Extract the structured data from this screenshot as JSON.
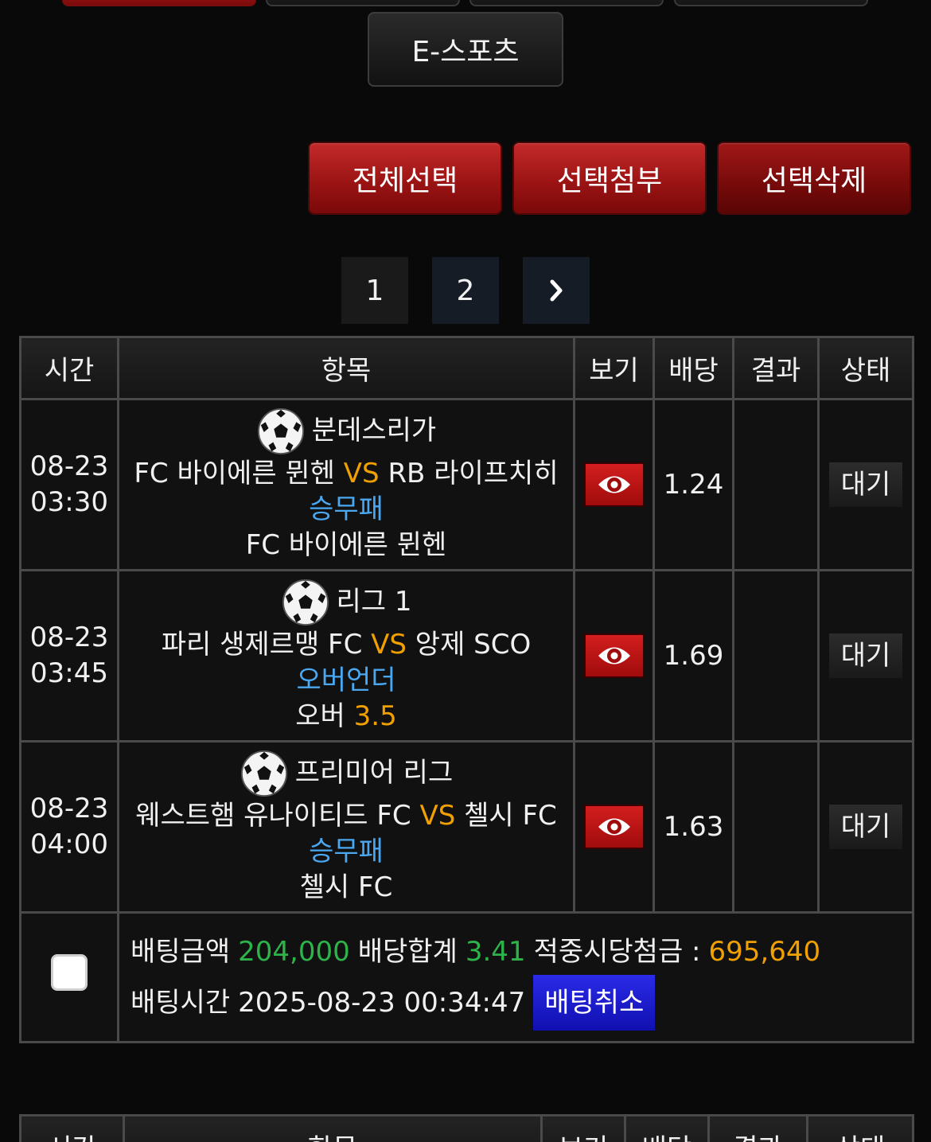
{
  "top_nav": {
    "esports_label": "E-스포츠"
  },
  "actions": {
    "select_all": "전체선택",
    "attach_selected": "선택첨부",
    "delete_selected": "선택삭제"
  },
  "pagination": {
    "pages": [
      "1",
      "2"
    ],
    "next": "›"
  },
  "table_headers": [
    "시간",
    "항목",
    "보기",
    "배당",
    "결과",
    "상태"
  ],
  "bets": [
    {
      "date": "08-23",
      "time": "03:30",
      "league": "분데스리가",
      "home": "FC 바이에른 뮌헨",
      "vs": "VS",
      "away": "RB 라이프치히",
      "market": "승무패",
      "pick": "FC 바이에른 뮌헨",
      "pick_value": "",
      "odds": "1.24",
      "result": "",
      "status": "대기"
    },
    {
      "date": "08-23",
      "time": "03:45",
      "league": "리그 1",
      "home": "파리 생제르맹 FC",
      "vs": "VS",
      "away": "앙제 SCO",
      "market": "오버언더",
      "pick": "오버",
      "pick_value": "3.5",
      "odds": "1.69",
      "result": "",
      "status": "대기"
    },
    {
      "date": "08-23",
      "time": "04:00",
      "league": "프리미어 리그",
      "home": "웨스트햄 유나이티드 FC",
      "vs": "VS",
      "away": "첼시 FC",
      "market": "승무패",
      "pick": "첼시 FC",
      "pick_value": "",
      "odds": "1.63",
      "result": "",
      "status": "대기"
    }
  ],
  "summary": {
    "bet_amount_label": "배팅금액",
    "bet_amount": "204,000",
    "total_odds_label": "배당합계",
    "total_odds": "3.41",
    "payout_label": "적중시당첨금 :",
    "payout": "695,640",
    "bet_time_label": "배팅시간",
    "bet_time": "2025-08-23 00:34:47",
    "cancel_label": "배팅취소"
  },
  "colors": {
    "accent_red": "#b01c1c",
    "odds_green": "#2db34a",
    "highlight_orange": "#f0a000",
    "market_blue": "#4aa7f0",
    "cancel_blue": "#1a1ad0"
  },
  "icons": {
    "sport": "soccer-ball-icon",
    "view": "eye-icon",
    "next": "chevron-right-icon"
  }
}
